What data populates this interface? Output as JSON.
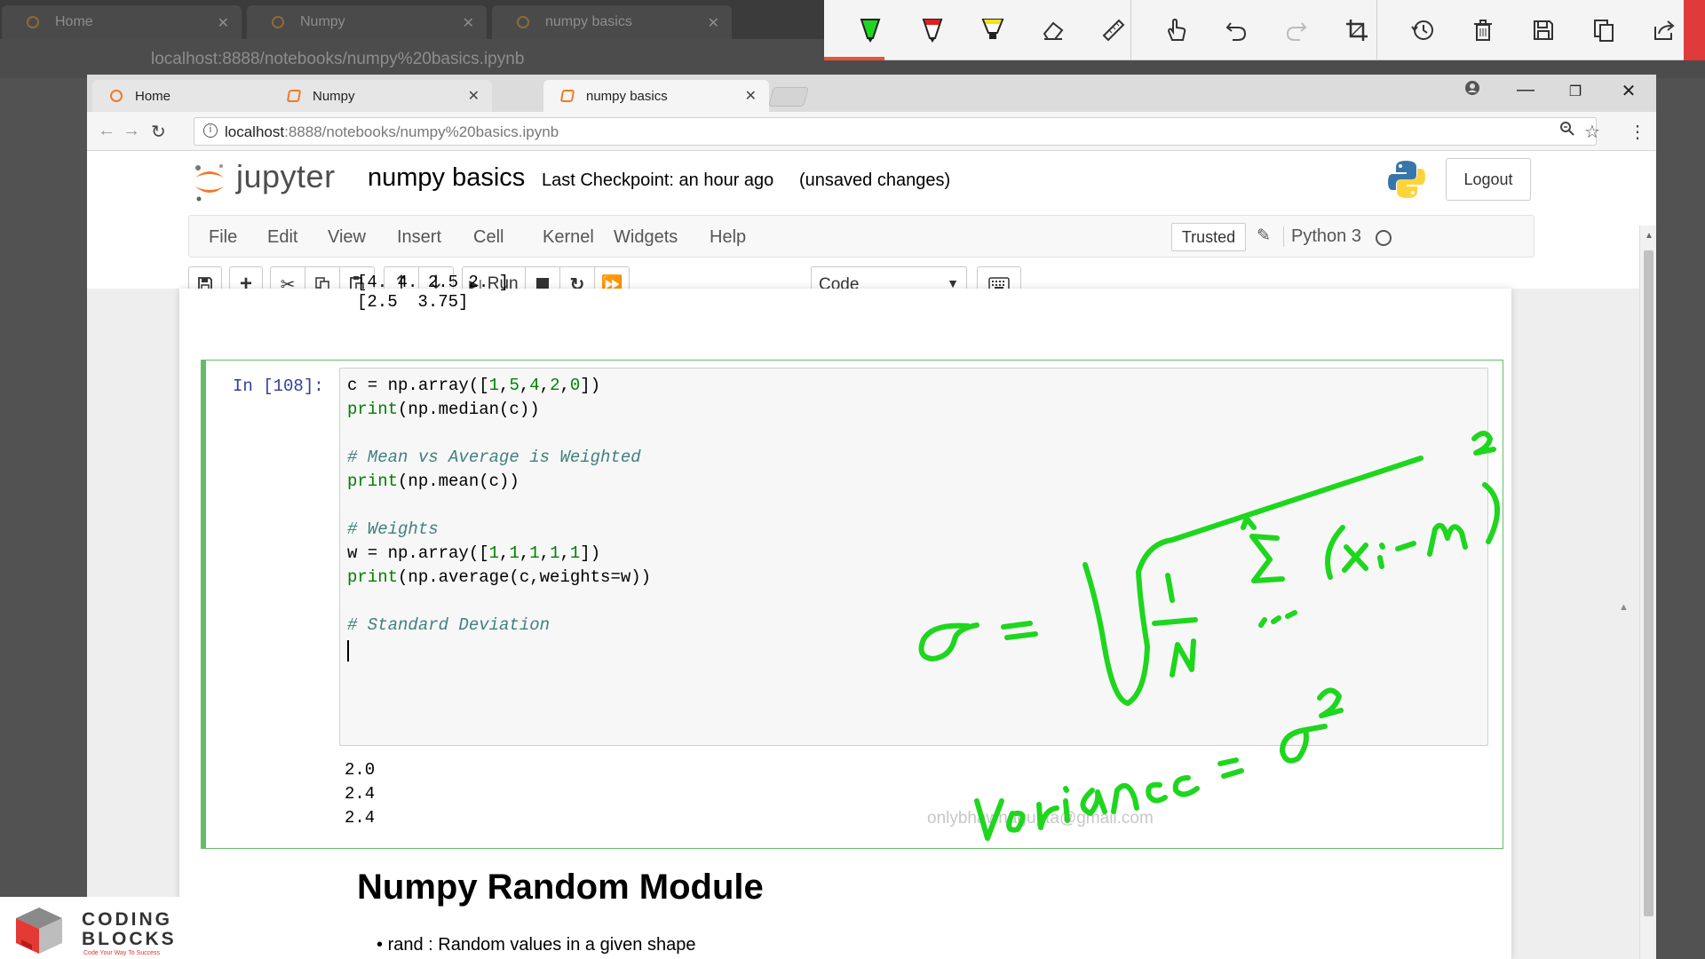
{
  "background_browser": {
    "tabs": [
      {
        "label": "Home"
      },
      {
        "label": "Numpy"
      },
      {
        "label": "numpy basics"
      }
    ],
    "url": "localhost:8888/notebooks/numpy%20basics.ipynb"
  },
  "annotation_toolbar": {
    "tools": [
      "pen-green-icon",
      "pen-red-icon",
      "highlighter-icon",
      "eraser-icon",
      "ruler-icon",
      "touch-writing-icon",
      "undo-icon",
      "redo-icon",
      "crop-icon",
      "history-icon",
      "trash-icon",
      "save-icon",
      "copy-icon",
      "share-icon"
    ],
    "active_color": "#e8533a"
  },
  "browser": {
    "tabs": [
      {
        "label": "Home"
      },
      {
        "label": "Numpy"
      },
      {
        "label": "numpy basics"
      }
    ],
    "url_host": "localhost",
    "url_path": ":8888/notebooks/numpy%20basics.ipynb"
  },
  "jupyter": {
    "brand": "jupyter",
    "notebook_name": "numpy basics",
    "checkpoint": "Last Checkpoint: an hour ago",
    "unsaved": "(unsaved changes)",
    "logout": "Logout",
    "menu": [
      "File",
      "Edit",
      "View",
      "Insert",
      "Cell",
      "Kernel",
      "Widgets",
      "Help"
    ],
    "trusted": "Trusted",
    "kernel": "Python 3",
    "run_label": "Run",
    "cell_type": "Code"
  },
  "notebook": {
    "prev_output_cut": "[4.  4.  2.5 2. ]",
    "prev_output_last": "[2.5  3.75]",
    "cell_prompt": "In [108]:",
    "code_lines": [
      "c = np.array([1,5,4,2,0])",
      "print(np.median(c))",
      "",
      "# Mean vs Average is Weighted",
      "print(np.mean(c))",
      "",
      "# Weights",
      "w = np.array([1,1,1,1,1])",
      "print(np.average(c,weights=w))",
      "",
      "# Standard Deviation"
    ],
    "outputs": [
      "2.0",
      "2.4",
      "2.4"
    ],
    "md_heading": "Numpy Random Module",
    "md_bullet": "rand : Random values in a given shape"
  },
  "watermark": "onlybhawnagupta@gmail.com",
  "logo": {
    "line1": "CODING",
    "line2": "BLOCKS",
    "tagline": "Code Your Way To Success"
  },
  "ink_color": "#1ed61e"
}
